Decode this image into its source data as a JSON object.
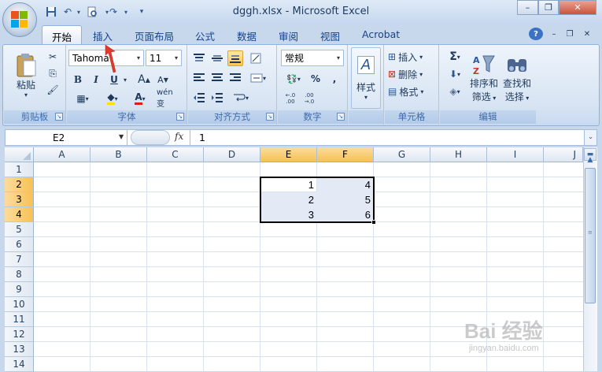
{
  "window": {
    "title": "dggh.xlsx - Microsoft Excel",
    "minimize": "–",
    "restore": "❐",
    "close": "✕",
    "help": "?",
    "doc_min": "–",
    "doc_restore": "❐",
    "doc_close": "✕"
  },
  "qat": {
    "save": "💾",
    "undo": "↶",
    "preview": "🔍",
    "redo": "↷",
    "customize": "▾"
  },
  "tabs": [
    "开始",
    "插入",
    "页面布局",
    "公式",
    "数据",
    "审阅",
    "视图",
    "Acrobat"
  ],
  "active_tab": "开始",
  "ribbon": {
    "clipboard": {
      "group_label": "剪贴板",
      "paste": "粘贴",
      "cut": "✂",
      "copy": "⎘",
      "format_painter": "🖌"
    },
    "font": {
      "group_label": "字体",
      "font_name": "Tahoma",
      "font_size": "11",
      "bold": "B",
      "italic": "I",
      "underline": "U",
      "grow": "A",
      "shrink": "A",
      "border": "▦",
      "fill": "A",
      "font_color": "A",
      "phonetic": "wén 变"
    },
    "alignment": {
      "group_label": "对齐方式"
    },
    "number": {
      "group_label": "数字",
      "format": "常规",
      "currency": "💱",
      "percent": "%",
      "comma": ",",
      "inc_dec": ".0 .00",
      "dec_dec": ".00 .0"
    },
    "styles": {
      "group_label": "",
      "label": "样式"
    },
    "cells": {
      "group_label": "单元格",
      "insert": "插入",
      "delete": "删除",
      "format": "格式"
    },
    "editing": {
      "group_label": "编辑",
      "sum": "Σ",
      "fill": "⬇",
      "clear": "◈",
      "sort": "排序和",
      "sort2": "筛选",
      "find": "查找和",
      "find2": "选择"
    }
  },
  "formula_bar": {
    "name_box": "E2",
    "fx": "fx",
    "value": "1"
  },
  "columns": [
    "A",
    "B",
    "C",
    "D",
    "E",
    "F",
    "G",
    "H",
    "I",
    "J"
  ],
  "selected_columns": [
    "E",
    "F"
  ],
  "rows": [
    "1",
    "2",
    "3",
    "4",
    "5",
    "6",
    "7",
    "8",
    "9",
    "10",
    "11",
    "12",
    "13",
    "14"
  ],
  "selected_rows": [
    "2",
    "3",
    "4"
  ],
  "cells": {
    "E2": "1",
    "F2": "4",
    "E3": "2",
    "F3": "5",
    "E4": "3",
    "F4": "6"
  },
  "watermark": {
    "main": "Bai 经验",
    "sub": "jingyan.baidu.com"
  }
}
